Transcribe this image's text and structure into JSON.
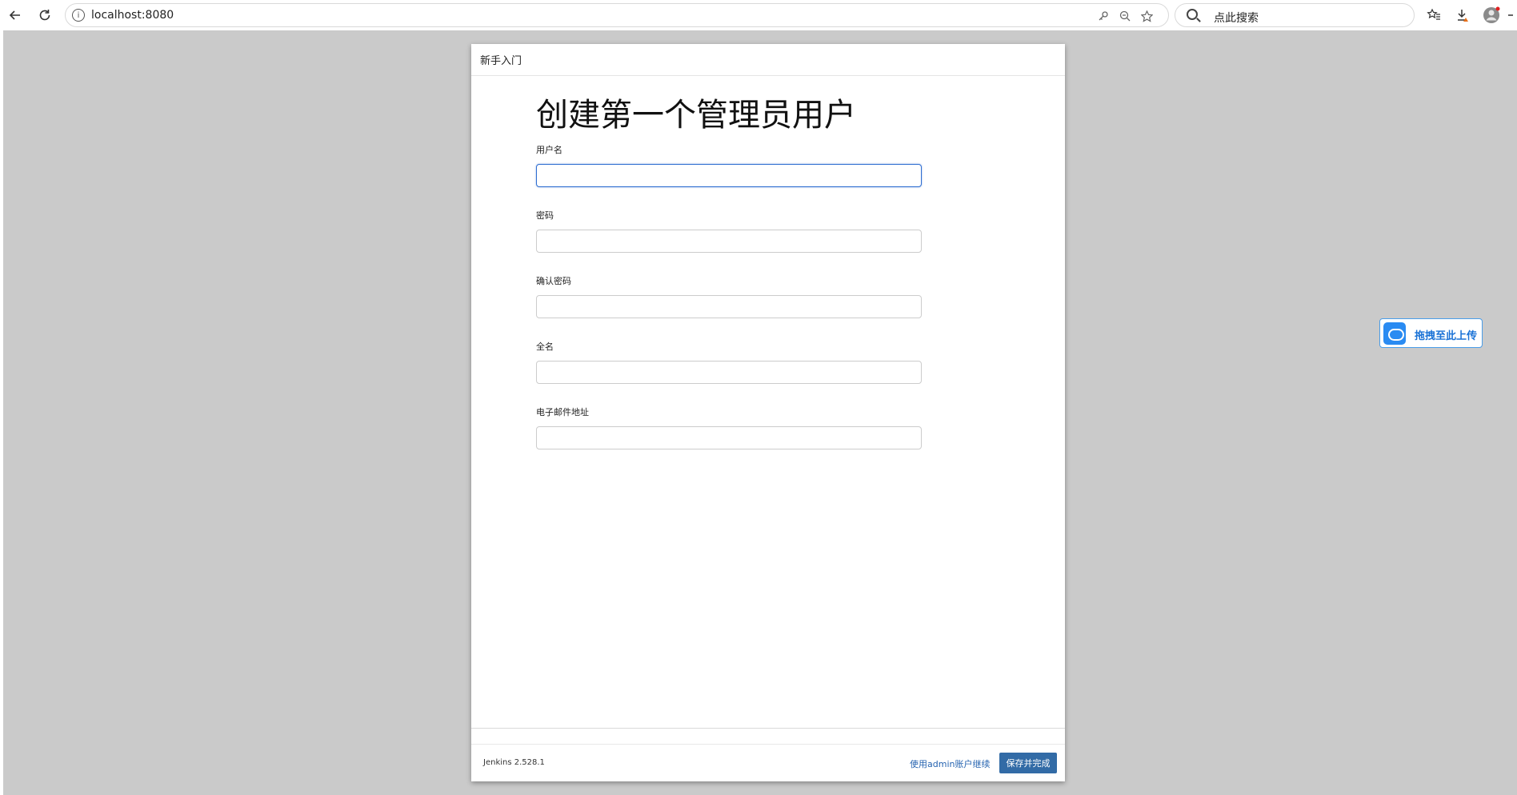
{
  "browser": {
    "url": "localhost:8080",
    "search_placeholder": "点此搜索"
  },
  "dialog": {
    "header_title": "新手入门",
    "heading": "创建第一个管理员用户",
    "fields": [
      {
        "label": "用户名",
        "value": ""
      },
      {
        "label": "密码",
        "value": ""
      },
      {
        "label": "确认密码",
        "value": ""
      },
      {
        "label": "全名",
        "value": ""
      },
      {
        "label": "电子邮件地址",
        "value": ""
      }
    ],
    "version": "Jenkins 2.528.1",
    "skip_link": "使用admin账户继续",
    "save_button": "保存并完成"
  },
  "upload_widget": {
    "label": "拖拽至此上传",
    "accent": "#2a8bf2"
  },
  "colors": {
    "page_bg": "#cacaca",
    "primary_button": "#326ba6",
    "link": "#2563b0",
    "focus_border": "#2f6ed1"
  }
}
